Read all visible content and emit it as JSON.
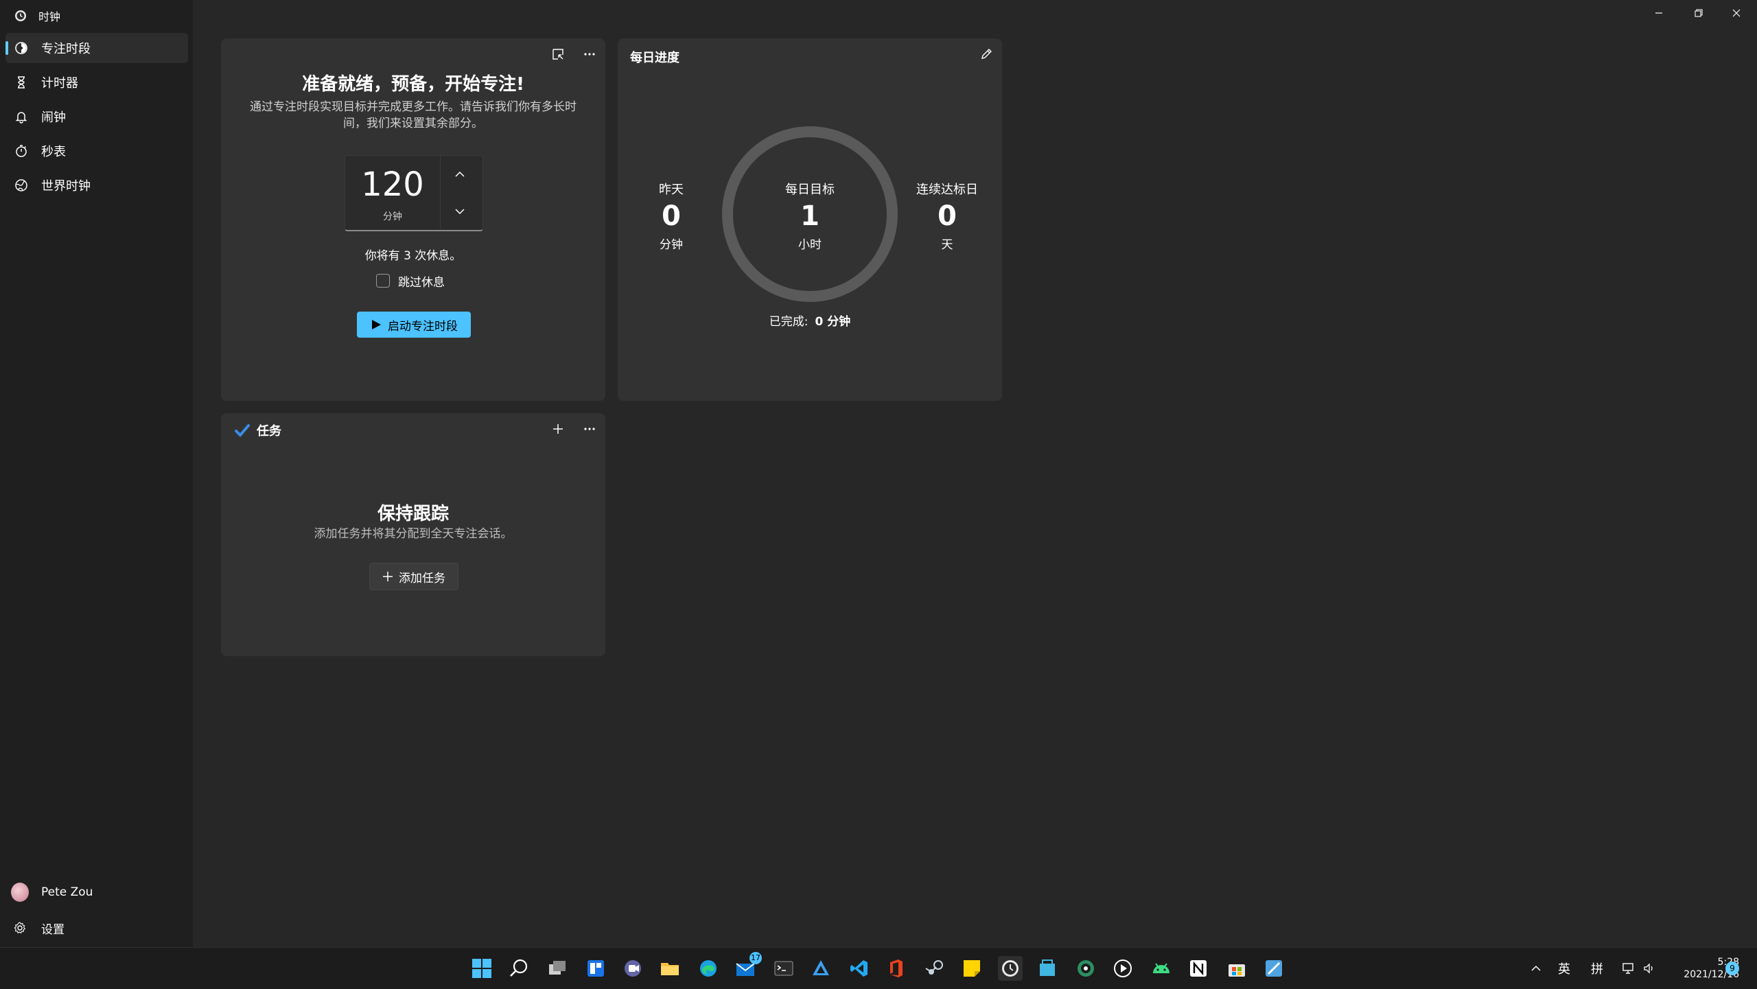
{
  "window": {
    "app_title": "时钟",
    "controls": {
      "minimize": "minimize-icon",
      "restore": "restore-icon",
      "close": "close-icon"
    }
  },
  "sidebar": {
    "items": [
      {
        "label": "专注时段",
        "icon": "focus-icon",
        "active": true
      },
      {
        "label": "计时器",
        "icon": "hourglass-icon",
        "active": false
      },
      {
        "label": "闹钟",
        "icon": "bell-icon",
        "active": false
      },
      {
        "label": "秒表",
        "icon": "stopwatch-icon",
        "active": false
      },
      {
        "label": "世界时钟",
        "icon": "globe-icon",
        "active": false
      }
    ],
    "user_name": "Pete Zou",
    "settings_label": "设置"
  },
  "focus_card": {
    "title": "准备就绪，预备，开始专注!",
    "description_line1": "通过专注时段实现目标并完成更多工作。请告诉我们你有多长时",
    "description_line2": "间，我们来设置其余部分。",
    "minutes_value": "120",
    "minutes_unit": "分钟",
    "breaks_text": "你将有 3 次休息。",
    "skip_breaks_label": "跳过休息",
    "skip_breaks_checked": false,
    "start_button_label": "启动专注时段"
  },
  "daily_progress": {
    "title": "每日进度",
    "yesterday_label": "昨天",
    "yesterday_value": "0",
    "yesterday_unit": "分钟",
    "goal_label": "每日目标",
    "goal_value": "1",
    "goal_unit": "小时",
    "streak_label": "连续达标日",
    "streak_value": "0",
    "streak_unit": "天",
    "completed_label": "已完成:",
    "completed_value": "0 分钟",
    "progress_fraction": 0
  },
  "tasks_card": {
    "title": "任务",
    "empty_title": "保持跟踪",
    "empty_desc": "添加任务并将其分配到全天专注会话。",
    "add_button_label": "添加任务"
  },
  "taskbar": {
    "mail_badge": "17",
    "tray_ime_lang": "英",
    "tray_ime_mode": "拼",
    "clock_time": "5:28",
    "clock_date": "2021/12/16",
    "notification_count": "9",
    "accent": "#60cdff"
  }
}
